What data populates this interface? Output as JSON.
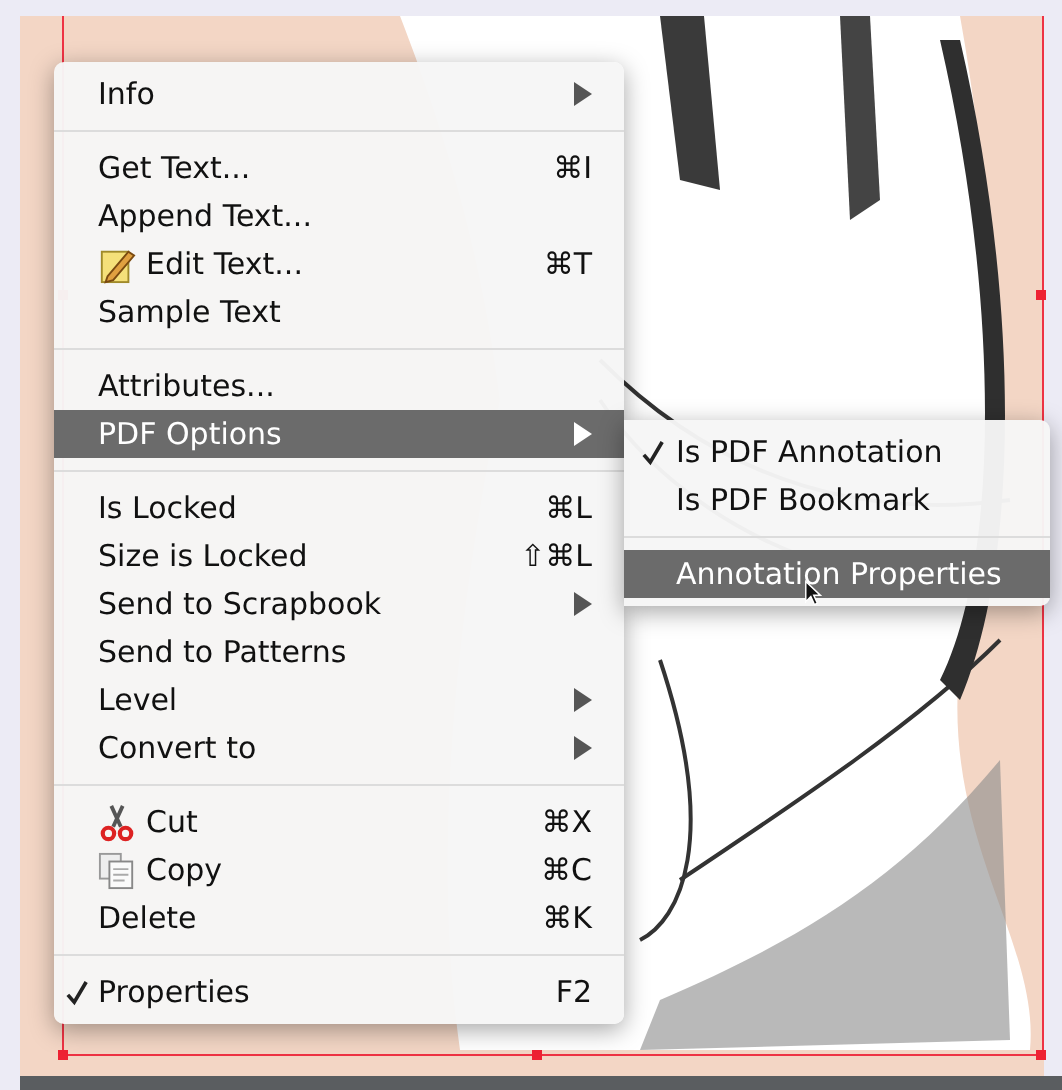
{
  "context_menu": {
    "sections": [
      [
        {
          "label": "Info",
          "submenu": true,
          "selected": false,
          "checked": false
        }
      ],
      [
        {
          "label": "Get Text...",
          "shortcut": "⌘I",
          "selected": false,
          "checked": false
        },
        {
          "label": "Append Text...",
          "selected": false,
          "checked": false
        },
        {
          "label": "Edit Text...",
          "shortcut": "⌘T",
          "kind": "pencil",
          "selected": false,
          "checked": false
        },
        {
          "label": "Sample Text",
          "selected": false,
          "checked": false
        }
      ],
      [
        {
          "label": "Attributes...",
          "selected": false,
          "checked": false
        },
        {
          "label": "PDF Options",
          "submenu": true,
          "selected": true,
          "checked": false
        }
      ],
      [
        {
          "label": "Is Locked",
          "shortcut": "⌘L",
          "selected": false,
          "checked": false
        },
        {
          "label": "Size is Locked",
          "shortcut": "⇧⌘L",
          "selected": false,
          "checked": false
        },
        {
          "label": "Send to Scrapbook",
          "submenu": true,
          "selected": false,
          "checked": false
        },
        {
          "label": "Send to Patterns",
          "selected": false,
          "checked": false
        },
        {
          "label": "Level",
          "submenu": true,
          "selected": false,
          "checked": false
        },
        {
          "label": "Convert to",
          "submenu": true,
          "selected": false,
          "checked": false
        }
      ],
      [
        {
          "label": "Cut",
          "shortcut": "⌘X",
          "kind": "scissors",
          "selected": false,
          "checked": false
        },
        {
          "label": "Copy",
          "shortcut": "⌘C",
          "kind": "copy",
          "selected": false,
          "checked": false
        },
        {
          "label": "Delete",
          "shortcut": "⌘K",
          "selected": false,
          "checked": false
        }
      ],
      [
        {
          "label": "Properties",
          "shortcut": "F2",
          "selected": false,
          "checked": true
        }
      ]
    ]
  },
  "submenu": {
    "sections": [
      [
        {
          "label": "Is PDF Annotation",
          "selected": false,
          "checked": true
        },
        {
          "label": "Is PDF Bookmark",
          "selected": false,
          "checked": false
        }
      ],
      [
        {
          "label": "Annotation Properties",
          "selected": true,
          "checked": false
        }
      ]
    ]
  }
}
